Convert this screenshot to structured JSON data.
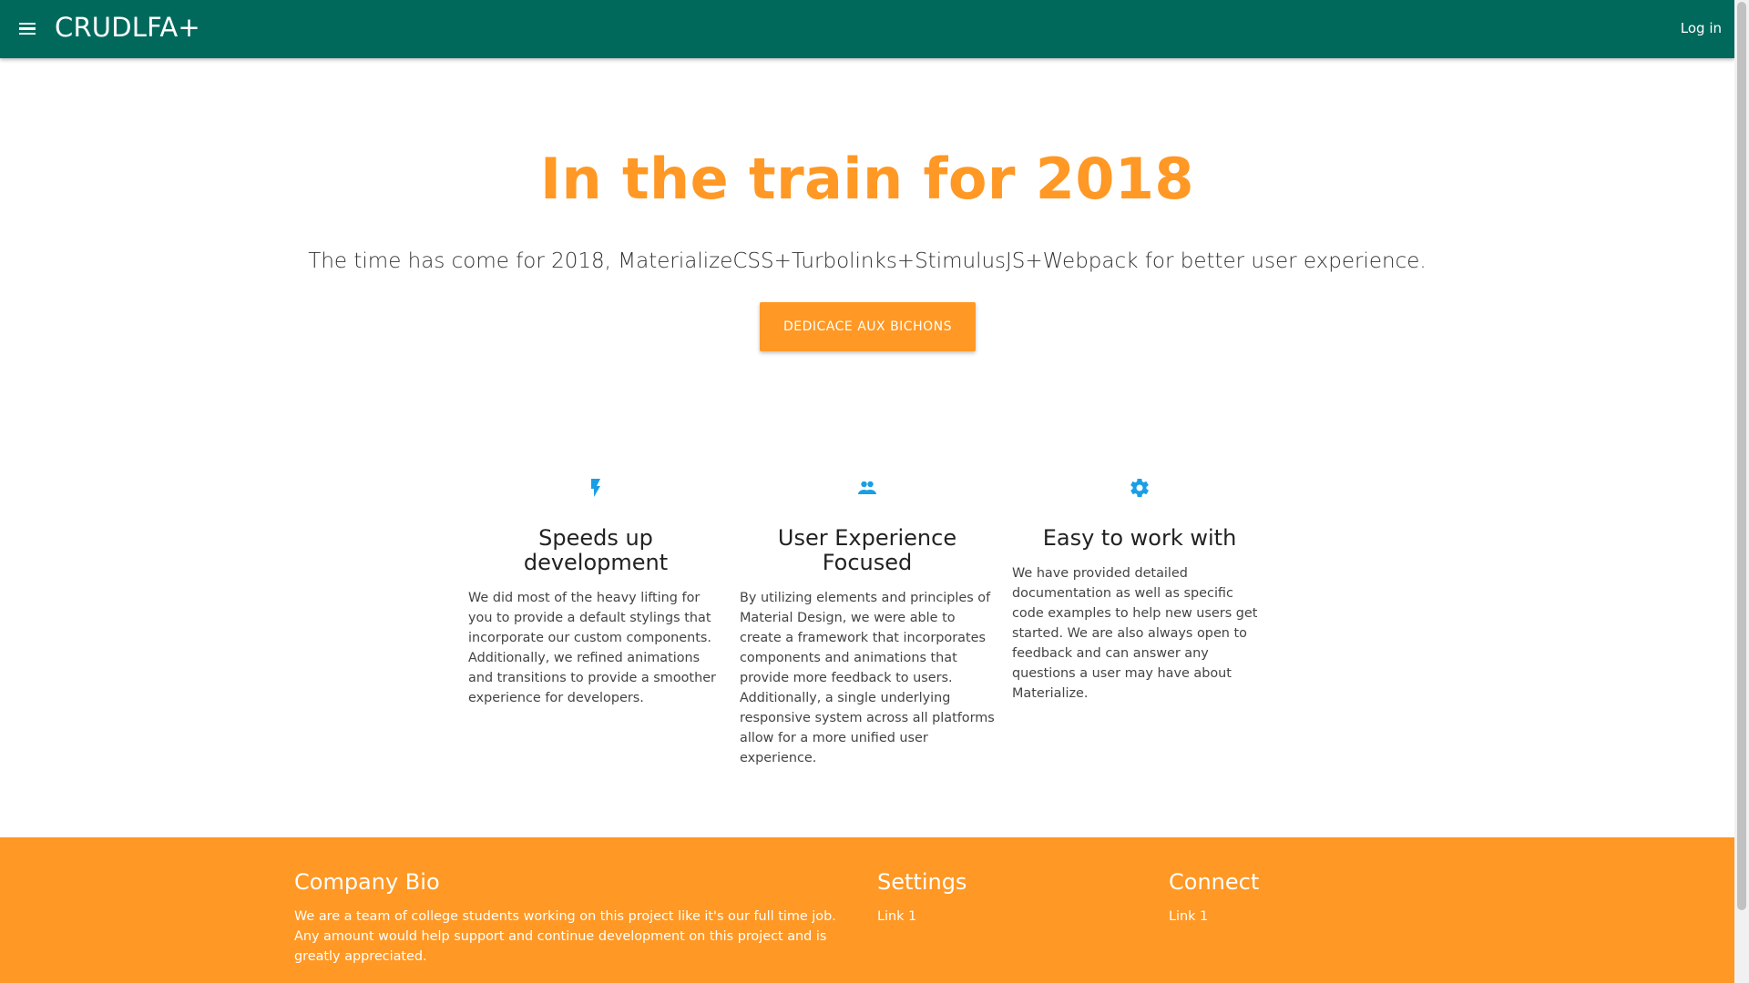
{
  "navbar": {
    "brand": "CRUDLFA+",
    "login_label": "Log in",
    "menu_icon": "menu-icon"
  },
  "hero": {
    "title": "In the train for 2018",
    "subtitle": "The time has come for 2018, MaterializeCSS+Turbolinks+StimulusJS+Webpack for better user experience.",
    "cta_label": "DEDICACE AUX BICHONS"
  },
  "features": [
    {
      "icon": "flash-icon",
      "title": "Speeds up development",
      "text": "We did most of the heavy lifting for you to provide a default stylings that incorporate our custom components. Additionally, we refined animations and transitions to provide a smoother experience for developers."
    },
    {
      "icon": "group-icon",
      "title": "User Experience Focused",
      "text": "By utilizing elements and principles of Material Design, we were able to create a framework that incorporates components and animations that provide more feedback to users. Additionally, a single underlying responsive system across all platforms allow for a more unified user experience."
    },
    {
      "icon": "settings-icon",
      "title": "Easy to work with",
      "text": "We have provided detailed documentation as well as specific code examples to help new users get started. We are also always open to feedback and can answer any questions a user may have about Materialize."
    }
  ],
  "footer": {
    "bio_title": "Company Bio",
    "bio_text": "We are a team of college students working on this project like it's our full time job. Any amount would help support and continue development on this project and is greatly appreciated.",
    "settings_title": "Settings",
    "settings_link": "Link 1",
    "connect_title": "Connect",
    "connect_link": "Link 1"
  },
  "colors": {
    "navbar": "#00695c",
    "accent": "#ff9824",
    "feature_icon": "#1a9ee5"
  }
}
